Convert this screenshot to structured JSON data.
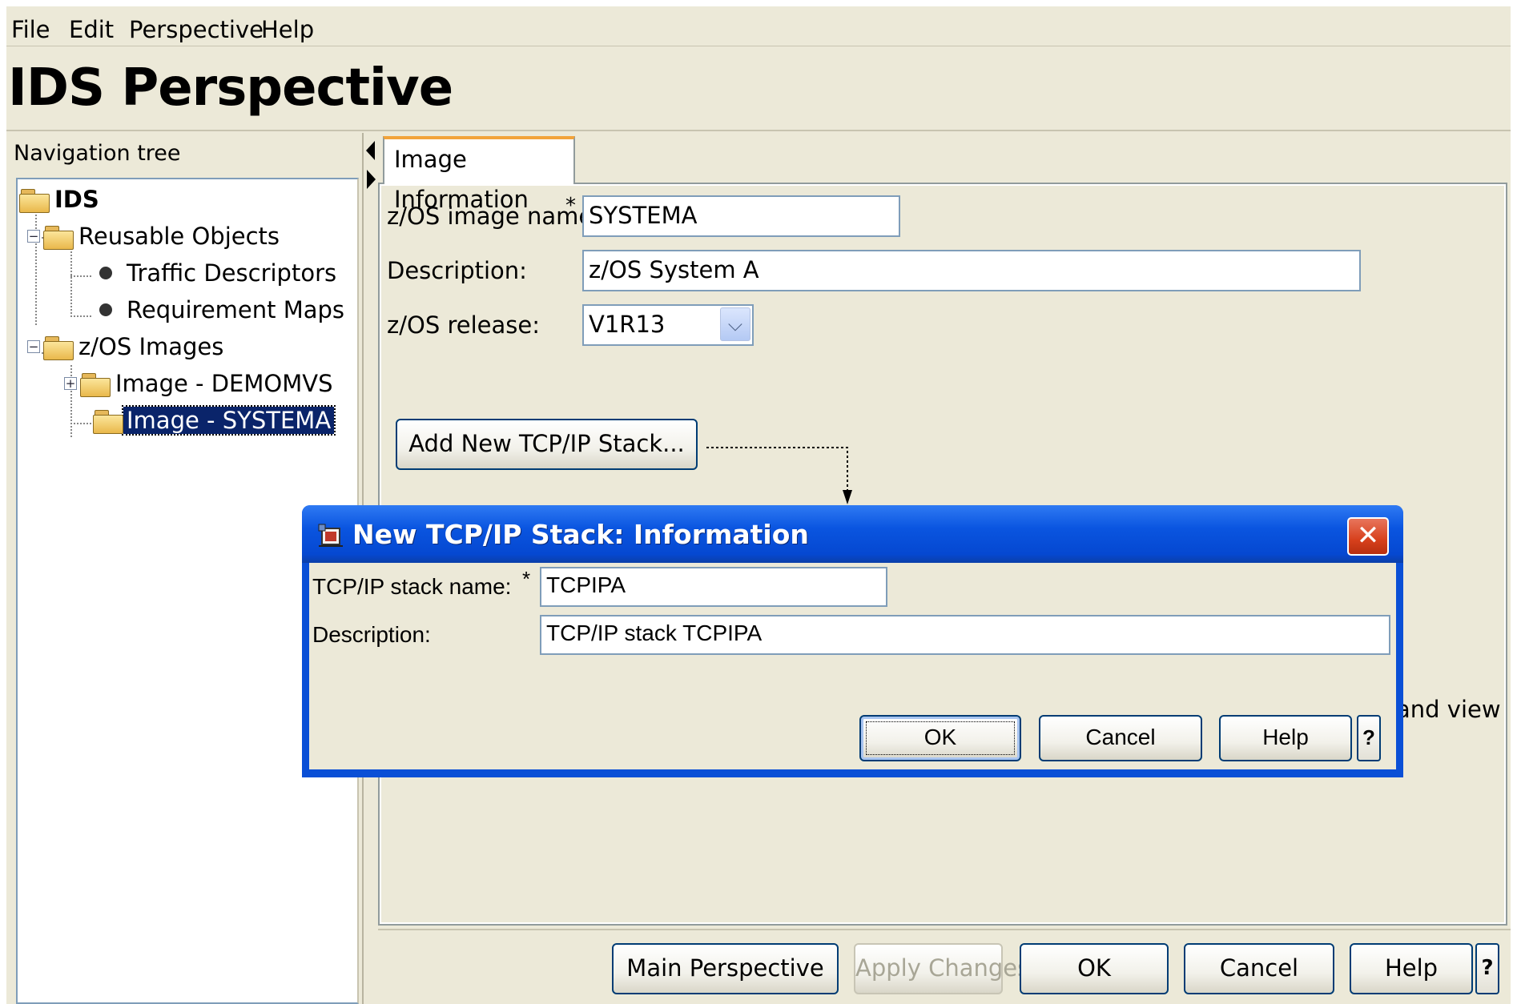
{
  "menu": [
    "File",
    "Edit",
    "Perspective",
    "Help"
  ],
  "page_title": "IDS Perspective",
  "nav": {
    "label": "Navigation tree",
    "tree": {
      "root": "IDS",
      "reusable_objects": "Reusable Objects",
      "traffic_descriptors": "Traffic Descriptors",
      "requirement_maps": "Requirement Maps",
      "zos_images": "z/OS Images",
      "image_demomvs": "Image - DEMOMVS",
      "image_systema": "Image - SYSTEMA",
      "expand_sign": "+",
      "collapse_sign": "−"
    }
  },
  "tab": {
    "label": "Image Information"
  },
  "form": {
    "image_name_label": "z/OS image name:",
    "image_name_value": "SYSTEMA",
    "required_mark": "*",
    "description_label": "Description:",
    "description_value": "z/OS System A",
    "release_label": "z/OS release:",
    "release_value": "V1R13",
    "add_stack_button": "Add New TCP/IP Stack...",
    "partial_text": "and view"
  },
  "bottom_buttons": {
    "main_perspective": "Main Perspective",
    "apply_changes": "Apply Changes",
    "ok": "OK",
    "cancel": "Cancel",
    "help": "Help",
    "question": "?"
  },
  "dialog": {
    "title": "New TCP/IP Stack: Information",
    "close": "✕",
    "stack_name_label": "TCP/IP stack name:",
    "stack_name_value": "TCPIPA",
    "required_mark": "*",
    "description_label": "Description:",
    "description_value": "TCP/IP stack TCPIPA",
    "ok": "OK",
    "cancel": "Cancel",
    "help": "Help",
    "question": "?"
  },
  "colors": {
    "window_bg": "#ece9d8",
    "dialog_title_blue": "#0a55e0",
    "selection_blue": "#0a246a",
    "tab_accent": "#f2a33a"
  }
}
